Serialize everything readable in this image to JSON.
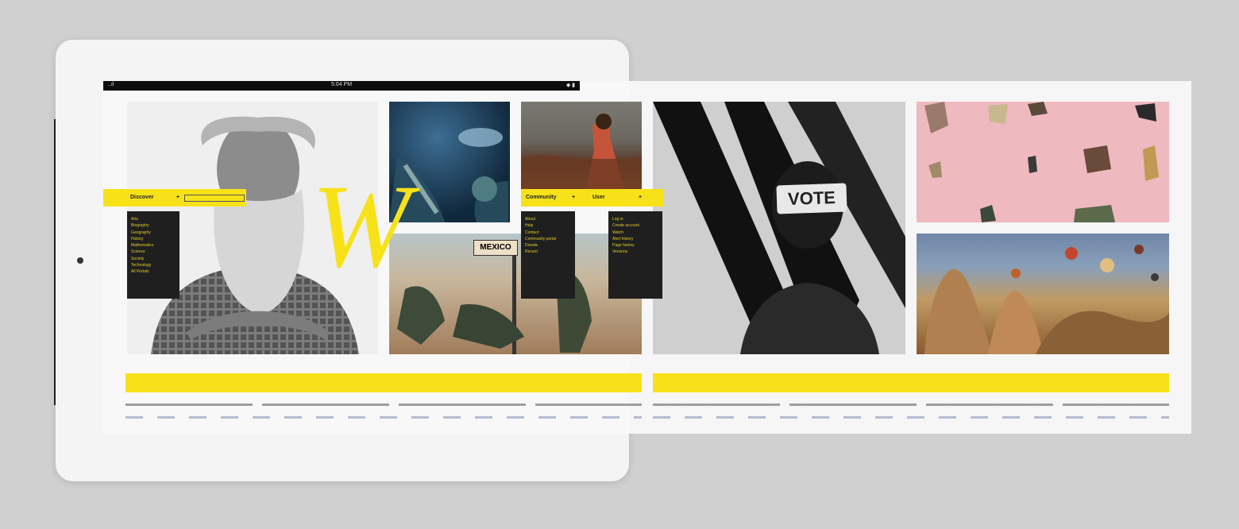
{
  "device": {
    "status_time": "5:04 PM",
    "signal": "..ıl",
    "battery": "◆ ▮"
  },
  "logo_letter": "W",
  "photo_labels": {
    "mexico_sign": "MEXICO",
    "vote_band": "VOTE"
  },
  "menus": {
    "discover": {
      "label": "Discover",
      "icon": "plus-icon",
      "items": [
        "Arts",
        "Biography",
        "Geography",
        "History",
        "Mathematics",
        "Science",
        "Society",
        "Technology",
        "All Portals"
      ]
    },
    "community": {
      "label": "Community",
      "icon": "plus-icon",
      "items": [
        "About",
        "Help",
        "Contact",
        "Community portal",
        "Donate",
        "Recent"
      ]
    },
    "user": {
      "label": "User",
      "icon": "plus-icon",
      "items": [
        "Log in",
        "Create account",
        "Watch",
        "Alert history",
        "Page history",
        "Versions"
      ]
    }
  },
  "colors": {
    "accent": "#f7e21a",
    "device_frame": "#f4f4f4",
    "background": "#d0d0d0",
    "menu_bg": "#1f1f1f"
  }
}
